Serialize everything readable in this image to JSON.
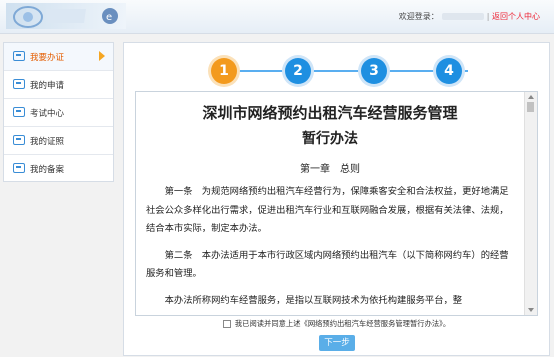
{
  "header": {
    "welcome_label": "欢迎登录：",
    "separator": "|",
    "return_link": "返回个人中心"
  },
  "sidebar": {
    "items": [
      {
        "label": "我要办证",
        "icon": "id-card-icon",
        "active": true
      },
      {
        "label": "我的申请",
        "icon": "edit-doc-icon",
        "active": false
      },
      {
        "label": "考试中心",
        "icon": "edit-doc-icon",
        "active": false
      },
      {
        "label": "我的证照",
        "icon": "id-card-icon",
        "active": false
      },
      {
        "label": "我的备案",
        "icon": "doc-icon",
        "active": false
      }
    ]
  },
  "steps": {
    "items": [
      "1",
      "2",
      "3",
      "4"
    ],
    "current": 1,
    "colors": {
      "current": "#f39a1d",
      "other": "#1e8fe1",
      "line": "#59aef0"
    }
  },
  "document": {
    "title": "深圳市网络预约出租汽车经营服务管理",
    "subtitle": "暂行办法",
    "chapter": "第一章　总则",
    "paragraphs": [
      "第一条　为规范网络预约出租汽车经营行为，保障乘客安全和合法权益，更好地满足社会公众多样化出行需求，促进出租汽车行业和互联网融合发展，根据有关法律、法规，结合本市实际，制定本办法。",
      "第二条　本办法适用于本市行政区域内网络预约出租汽车（以下简称网约车）的经营服务和管理。",
      "本办法所称网约车经营服务，是指以互联网技术为依托构建服务平台，整"
    ]
  },
  "agreement": {
    "label": "我已阅读并同意上述《网络预约出租汽车经营服务管理暂行办法》。"
  },
  "actions": {
    "next_label": "下一步"
  }
}
